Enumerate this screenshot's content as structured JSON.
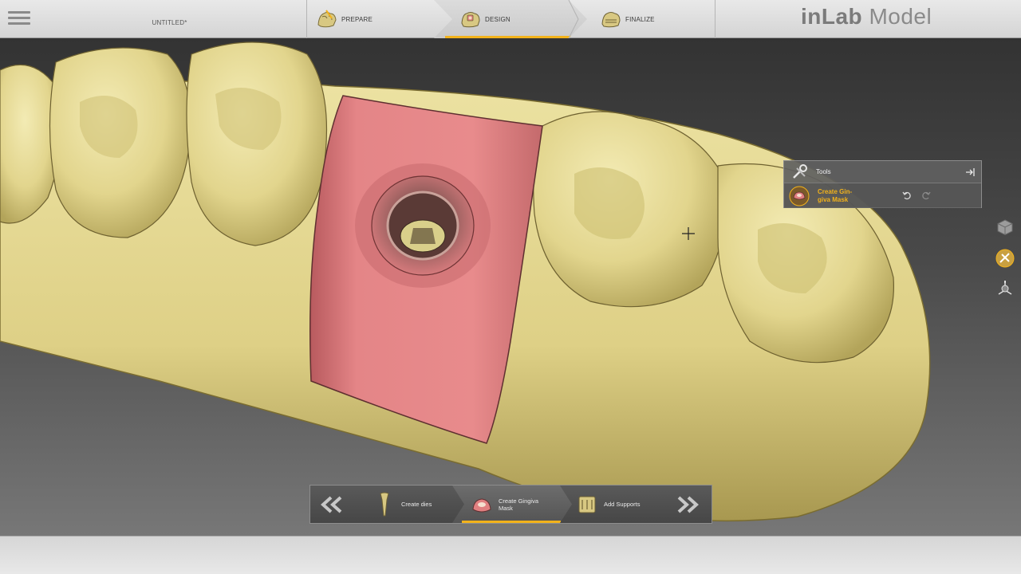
{
  "header": {
    "document_title": "UNTITLED*",
    "brand_prefix": "inLab",
    "brand_suffix": " Model",
    "steps": [
      {
        "label": "PREPARE",
        "active": false
      },
      {
        "label": "DESIGN",
        "active": true
      },
      {
        "label": "FINALIZE",
        "active": false
      }
    ]
  },
  "tools_panel": {
    "title": "Tools",
    "active_tool_label": "Create Gin-giva Mask",
    "active_tool_line1": "Create Gin-",
    "active_tool_line2": "giva Mask"
  },
  "substeps": {
    "items": [
      {
        "label": "Create dies",
        "active": false
      },
      {
        "label_line1": "Create Gingiva",
        "label_line2": "Mask",
        "active": true
      },
      {
        "label": "Add Supports",
        "active": false
      }
    ]
  },
  "colors": {
    "accent": "#f2b21b",
    "model_yellow": "#e8dc96",
    "gingiva_mask": "#e07f80",
    "panel_gray": "#606060"
  },
  "icons": {
    "menu": "hamburger-menu-icon",
    "prepare": "prepare-model-icon",
    "design": "design-model-icon",
    "finalize": "finalize-model-icon",
    "tools": "tools-wrench-icon",
    "pin": "pin-panel-icon",
    "undo": "undo-icon",
    "redo": "redo-icon",
    "cube": "view-cube-icon",
    "design_tool": "design-tool-icon",
    "axis": "axis-orientation-icon",
    "cross": "crosshair-cursor-icon",
    "prev": "previous-step-icon",
    "next": "next-step-icon"
  }
}
